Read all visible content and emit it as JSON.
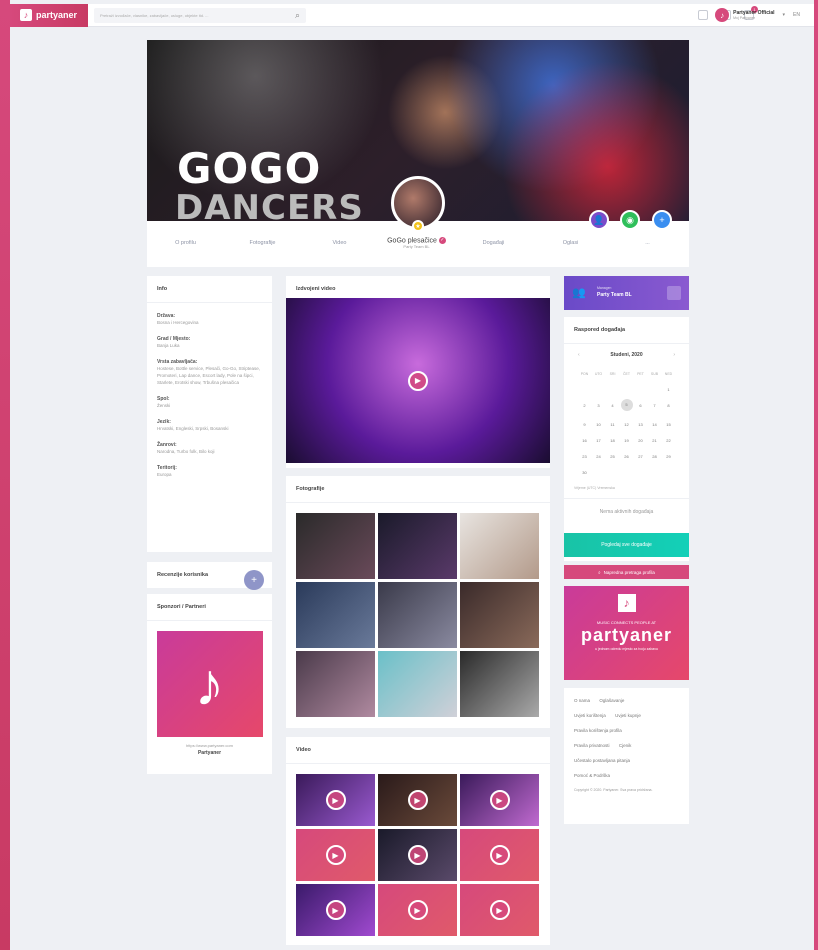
{
  "topbar": {
    "logo": "partyaner",
    "search_placeholder": "Pretraži izvođače, vlasnike, zabavljače, usluge, objekte itd. ...",
    "notification_count": "1",
    "user_name": "Partyaner Official",
    "user_sub": "Moj Partyaner",
    "lang": "EN"
  },
  "cover": {
    "title_line1": "GOGO",
    "title_line2": "DANCERS"
  },
  "profile": {
    "name": "GoGo plesačice",
    "subtitle": "Party Team BL",
    "nav": [
      "O profilu",
      "Fotografije",
      "Video",
      "Događaji",
      "Oglasi",
      "..."
    ]
  },
  "info": {
    "title": "Info",
    "items": [
      {
        "label": "Država:",
        "value": "Bosna i Hercegovina"
      },
      {
        "label": "Grad / Mjesto:",
        "value": "Banja Luka"
      },
      {
        "label": "Vrsta zabavljača:",
        "value": "Hostese, Bottle service, Plesači, Go-Go, Striptease, Promoteri, Lap dance, Escort lady, Pole na šipci, Starlete, Erotski show, Trbušna plesačica"
      },
      {
        "label": "Spol:",
        "value": "Ženski"
      },
      {
        "label": "Jezik:",
        "value": "Hrvatski, Engleski, Srpski, Bosanski"
      },
      {
        "label": "Žanrovi:",
        "value": "Narodna, Turbo folk, Bilo koji"
      },
      {
        "label": "Teritorij:",
        "value": "Europa"
      }
    ]
  },
  "reviews": {
    "title": "Recenzije korisnika",
    "add": "+"
  },
  "sponsors": {
    "title": "Sponzori / Partneri",
    "url": "https://www.partyaner.com",
    "name": "Partyaner"
  },
  "featured": {
    "title": "Izdvojeni video"
  },
  "photos": {
    "title": "Fotografije"
  },
  "videos": {
    "title": "Video"
  },
  "manager": {
    "label": "Manager:",
    "name": "Party Team BL"
  },
  "schedule": {
    "title": "Raspored događaja",
    "month": "Studeni, 2020",
    "prev": "‹",
    "next": "›",
    "weekdays": [
      "PON",
      "UTO",
      "SRI",
      "ČET",
      "PET",
      "SUB",
      "NED"
    ],
    "weeks": [
      [
        "",
        "",
        "",
        "",
        "",
        "",
        "1"
      ],
      [
        "2",
        "3",
        "4",
        "5",
        "6",
        "7",
        "8"
      ],
      [
        "9",
        "10",
        "11",
        "12",
        "13",
        "14",
        "15"
      ],
      [
        "16",
        "17",
        "18",
        "19",
        "20",
        "21",
        "22"
      ],
      [
        "23",
        "24",
        "25",
        "26",
        "27",
        "28",
        "29"
      ],
      [
        "30",
        "",
        "",
        "",
        "",
        "",
        ""
      ]
    ],
    "timezone": "Vrijeme (UTC) Vremenska",
    "empty": "Nema aktivnih događaja",
    "view_all": "Pogledaj sve događaje",
    "advanced_search": "Napredna pretraga profila"
  },
  "promo": {
    "tagline": "MUSIC CONNECTS PEOPLE AT",
    "brand": "partyaner",
    "sub": "u jednom odredu mjesto za tvoju zabavu"
  },
  "footer": {
    "links": [
      "O nama",
      "Oglašavanje",
      "Uvjeti korištenja",
      "Uvjeti kupnje",
      "Pravila korištenja profila",
      "Pravila privatnosti",
      "Cjenik",
      "Učestalo postavljana pitanja",
      "Pomoć & Podrška"
    ],
    "copyright": "Copyright © 2020. Partyaner. Sva prava pridržana."
  }
}
